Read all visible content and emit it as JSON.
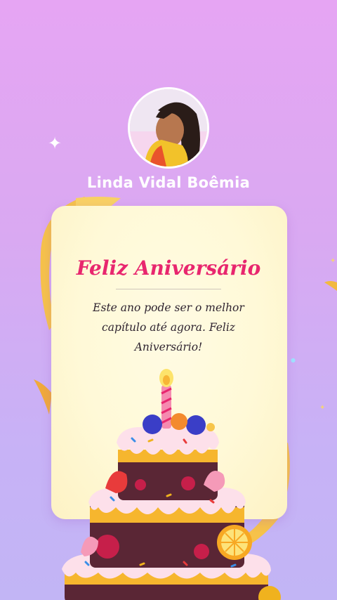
{
  "profile": {
    "name": "Linda Vidal Boêmia",
    "avatar_icon": "user-photo-icon"
  },
  "card": {
    "title": "Feliz Aniversário",
    "message": "Este ano pode ser o melhor capítulo até agora. Feliz Aniversário!"
  },
  "colors": {
    "background_top": "#e6a5f3",
    "background_bottom": "#c2b5f5",
    "title": "#e8266e",
    "card": "#fff9d7",
    "ribbon": "#f7c54a",
    "frosting": "#fde0ea",
    "cake_dark": "#5a2635"
  },
  "icons": [
    "sparkle-icon",
    "ribbon-decoration",
    "birthday-cake-illustration",
    "candle-icon"
  ]
}
